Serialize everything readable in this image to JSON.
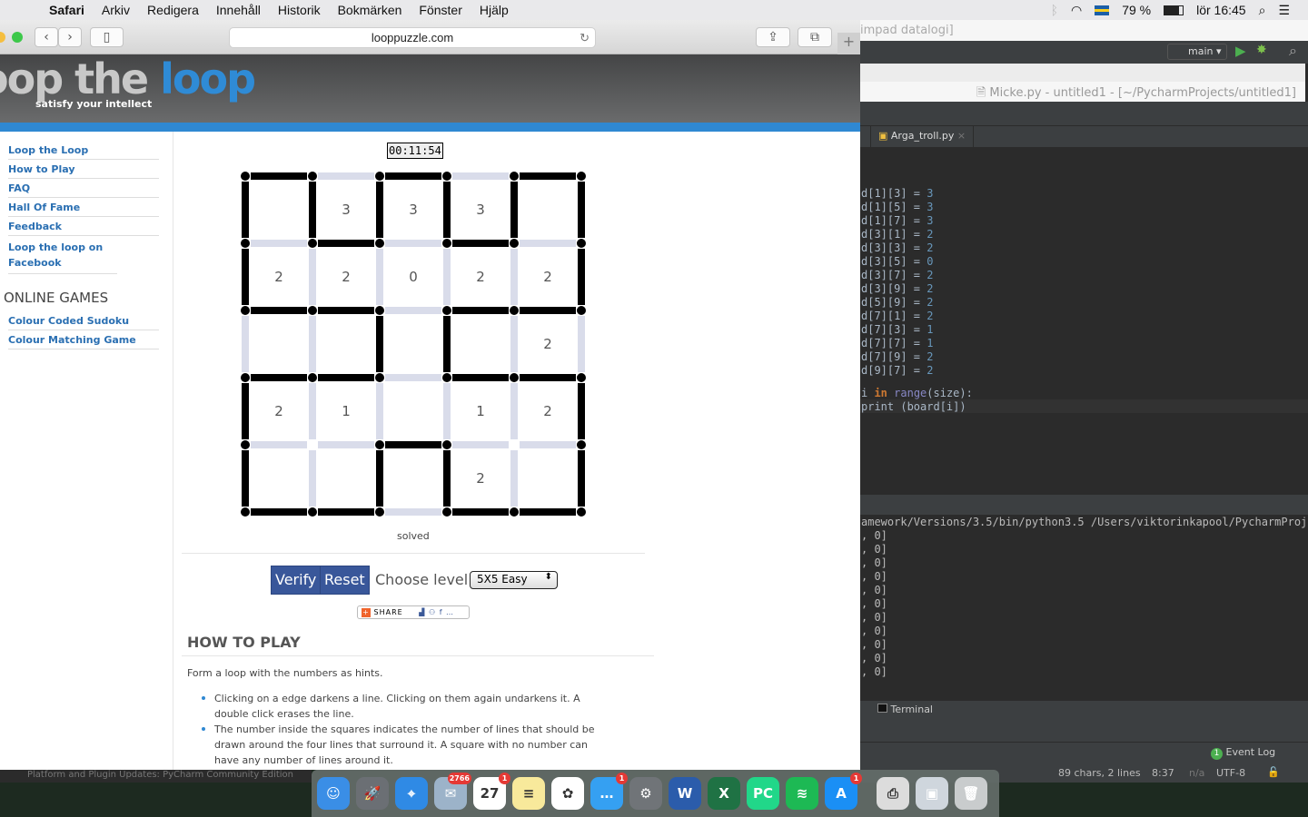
{
  "menubar": {
    "app": "Safari",
    "items": [
      "Arkiv",
      "Redigera",
      "Innehåll",
      "Historik",
      "Bokmärken",
      "Fönster",
      "Hjälp"
    ],
    "battery": "79 %",
    "clock": "lör 16:45"
  },
  "browser": {
    "url": "looppuzzle.com"
  },
  "site": {
    "logo_gray": "oop the",
    "logo_blue": "loop",
    "tagline": "satisfy your intellect",
    "nav": [
      "Loop the Loop",
      "How to Play",
      "FAQ",
      "Hall Of Fame",
      "Feedback",
      "Loop the loop on Facebook"
    ],
    "games_heading": "ONLINE GAMES",
    "games": [
      "Colour Coded Sudoku",
      "Colour Matching Game"
    ]
  },
  "puzzle": {
    "timer": "00:11:54",
    "status": "solved",
    "numbers": [
      [
        "",
        "3",
        "3",
        "3",
        ""
      ],
      [
        "2",
        "2",
        "0",
        "2",
        "2"
      ],
      [
        "",
        "",
        "",
        "",
        "2"
      ],
      [
        "2",
        "1",
        "",
        "1",
        "2"
      ],
      [
        "",
        "",
        "",
        "2",
        ""
      ]
    ],
    "h_edges": [
      [
        1,
        0,
        1,
        0,
        1
      ],
      [
        0,
        1,
        0,
        1,
        0
      ],
      [
        1,
        1,
        0,
        1,
        1
      ],
      [
        1,
        1,
        0,
        1,
        1
      ],
      [
        0,
        0,
        1,
        0,
        0
      ],
      [
        1,
        1,
        0,
        1,
        1
      ]
    ],
    "v_edges": [
      [
        1,
        1,
        1,
        1,
        1,
        1
      ],
      [
        1,
        0,
        0,
        0,
        0,
        1
      ],
      [
        0,
        0,
        1,
        1,
        0,
        0
      ],
      [
        1,
        0,
        0,
        0,
        0,
        1
      ],
      [
        1,
        0,
        1,
        1,
        0,
        1
      ]
    ],
    "verify": "Verify",
    "reset": "Reset",
    "level_label": "Choose level:",
    "level": "5X5 Easy",
    "share": "SHARE"
  },
  "howto": {
    "heading": "HOW TO PLAY",
    "intro": "Form a loop with the numbers as hints.",
    "bullets": [
      "Clicking on a edge darkens a line. Clicking on them again undarkens it. A double click erases the line.",
      "The number inside the squares indicates the number of lines that should be drawn around the four lines that surround it. A square with no number can have any number of lines around it."
    ]
  },
  "ide": {
    "bg_title": "impad datalogi]",
    "run_config": "main",
    "window_title": "Micke.py - untitled1 - [~/PycharmProjects/untitled1]",
    "tab": "Arga_troll.py",
    "code": [
      [
        "d[1][3] = ",
        "3"
      ],
      [
        "d[1][5] = ",
        "3"
      ],
      [
        "d[1][7] = ",
        "3"
      ],
      [
        "d[3][1] = ",
        "2"
      ],
      [
        "d[3][3] = ",
        "2"
      ],
      [
        "d[3][5] = ",
        "0"
      ],
      [
        "d[3][7] = ",
        "2"
      ],
      [
        "d[3][9] = ",
        "2"
      ],
      [
        "d[5][9] = ",
        "2"
      ],
      [
        "d[7][1] = ",
        "2"
      ],
      [
        "d[7][3] = ",
        "1"
      ],
      [
        "d[7][7] = ",
        "1"
      ],
      [
        "d[7][9] = ",
        "2"
      ],
      [
        "d[9][7] = ",
        "2"
      ]
    ],
    "loop_line": {
      "a": "i ",
      "kw": "in",
      "fn": "range",
      "rest": "(size):"
    },
    "print_line": "print (board[i])",
    "run_cmd": "amework/Versions/3.5/bin/python3.5 /Users/viktorinkapool/PycharmProjec",
    "output_line": ", 0]",
    "output_count": 11,
    "terminal": "Terminal",
    "event_log": "Event Log",
    "event_count": "1",
    "status": {
      "chars": "89 chars, 2 lines",
      "pos": "8:37",
      "na": "n/a",
      "enc": "UTF-8"
    }
  },
  "notification": "Platform and Plugin Updates: PyCharm Community Edition",
  "dock": [
    {
      "name": "finder",
      "color": "#3a8ee6",
      "g": "☺"
    },
    {
      "name": "launchpad",
      "color": "#6b6f74",
      "g": "🚀"
    },
    {
      "name": "safari",
      "color": "#2f8ae5",
      "g": "⌖"
    },
    {
      "name": "mail",
      "color": "#9cb3c9",
      "g": "✉",
      "badge": "2766"
    },
    {
      "name": "calendar",
      "color": "#ffffff",
      "g": "27",
      "badge": "1"
    },
    {
      "name": "notes",
      "color": "#f8e99b",
      "g": "≡"
    },
    {
      "name": "photos",
      "color": "#ffffff",
      "g": "✿"
    },
    {
      "name": "messages",
      "color": "#35a0f2",
      "g": "…",
      "badge": "1"
    },
    {
      "name": "system-preferences",
      "color": "#707478",
      "g": "⚙"
    },
    {
      "name": "word",
      "color": "#2b5cab",
      "g": "W"
    },
    {
      "name": "excel",
      "color": "#1f7244",
      "g": "X"
    },
    {
      "name": "pycharm",
      "color": "#21d789",
      "g": "PC"
    },
    {
      "name": "spotify",
      "color": "#1db954",
      "g": "≋"
    },
    {
      "name": "app-store",
      "color": "#1a8ff5",
      "g": "A",
      "badge": "1"
    },
    {
      "name": "printer",
      "color": "#dcdcdc",
      "g": "⎙"
    },
    {
      "name": "preview",
      "color": "#cfd6dd",
      "g": "▣"
    },
    {
      "name": "trash",
      "color": "#c9cccd",
      "g": "🗑"
    }
  ]
}
